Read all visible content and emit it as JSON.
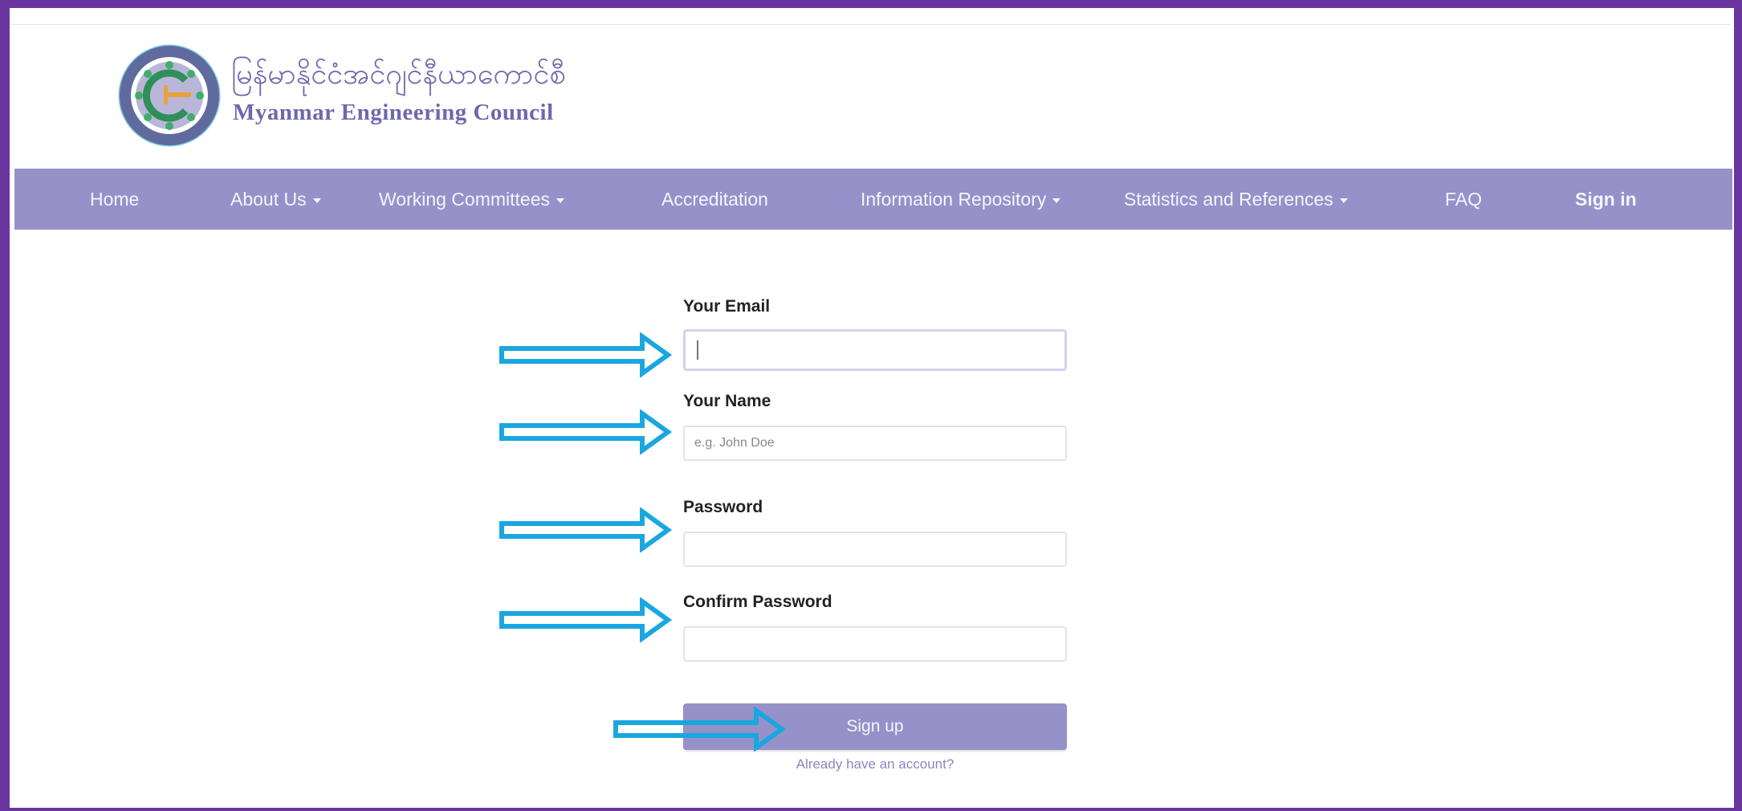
{
  "brand": {
    "myanmar_name": "မြန်မာနိုင်ငံအင်ဂျင်နီယာကောင်စီ",
    "english_name": "Myanmar Engineering Council",
    "logo_icon": "mec-logo-icon"
  },
  "nav": {
    "items": [
      {
        "label": "Home",
        "dropdown": false
      },
      {
        "label": "About Us",
        "dropdown": true
      },
      {
        "label": "Working Committees",
        "dropdown": true
      },
      {
        "label": "Accreditation",
        "dropdown": false
      },
      {
        "label": "Information Repository",
        "dropdown": true
      },
      {
        "label": "Statistics and References",
        "dropdown": true
      },
      {
        "label": "FAQ",
        "dropdown": false
      },
      {
        "label": "Sign in",
        "dropdown": false,
        "bold": true
      }
    ]
  },
  "form": {
    "email_label": "Your Email",
    "email_value": "",
    "name_label": "Your Name",
    "name_placeholder": "e.g. John Doe",
    "password_label": "Password",
    "confirm_label": "Confirm Password",
    "submit_label": "Sign up",
    "signin_link": "Already have an account?"
  },
  "colors": {
    "frame": "#6b35a0",
    "navbar": "#9691c8",
    "brand_text": "#6e68ad",
    "arrow": "#1aa7e0"
  }
}
